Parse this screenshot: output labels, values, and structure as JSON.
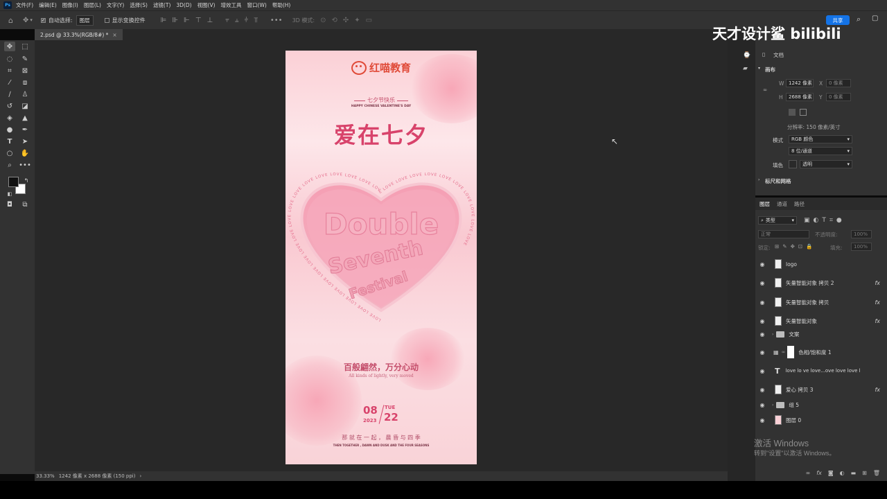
{
  "menubar": {
    "items": [
      "文件(F)",
      "编辑(E)",
      "图像(I)",
      "图层(L)",
      "文字(Y)",
      "选择(S)",
      "滤镜(T)",
      "3D(D)",
      "视图(V)",
      "增效工具",
      "窗口(W)",
      "帮助(H)"
    ]
  },
  "options": {
    "auto_select_label": "自动选择:",
    "auto_select_value": "图层",
    "show_transform_label": "显示变换控件",
    "mode3d_label": "3D 模式:",
    "share_label": "共享"
  },
  "doc_tab": {
    "title": "2.psd @ 33.3%(RGB/8#) *"
  },
  "status": {
    "zoom": "33.33%",
    "info": "1242 像素 x 2688 像素 (150 ppi)"
  },
  "watermark": {
    "text": "天才设计鲨 bilibili"
  },
  "poster": {
    "brand": "红喵教育",
    "subtitle_cn": "七夕节快乐",
    "subtitle_en": "HAPPY CHINESE VALENTINE'S DAY",
    "title": "爱在七夕",
    "heart_ring_text": "LOVE LOVE LOVE LOVE LOVE LOVE LOVE LOVE LOVE LOVE LOVE LOVE LOVE LOVE LOVE LOVE LOVE LOVE LOVE LOVE LOVE LOVE LOVE LOVE LOVE LOVE LOVE LOVE",
    "heart_word1": "Double",
    "heart_word2": "Seventh",
    "heart_word3": "Festival",
    "slogan_cn": "百般翩然，万分心动",
    "slogan_en": "All kinds of lightly, very moved",
    "date_month": "08",
    "date_year": "2023",
    "date_weekday": "TUE",
    "date_day": "22",
    "footer_cn": "那 就 在 一 起 ， 晨 昏 与 四 季",
    "footer_en": "THEN TOGETHER , DAWN AND DUSK AND THE FOUR SEASONS"
  },
  "properties": {
    "doc_label": "文档",
    "canvas_section": "画布",
    "w_label": "W",
    "w_value": "1242 像素",
    "h_label": "H",
    "h_value": "2688 像素",
    "x_label": "X",
    "x_value": "0 像素",
    "y_label": "Y",
    "y_value": "0 像素",
    "resolution": "分辨率: 150 像素/英寸",
    "mode_label": "模式",
    "mode_value": "RGB 颜色",
    "depth_value": "8 位/通道",
    "fill_label": "填色",
    "fill_value": "透明",
    "rulers_section": "标尺和网格"
  },
  "layers": {
    "tabs": [
      "图层",
      "通道",
      "路径"
    ],
    "filter_label": "类型",
    "blend_mode": "正常",
    "opacity_label": "不透明度:",
    "opacity_value": "100%",
    "lock_label": "锁定:",
    "fill_label": "填充:",
    "fill_value": "100%",
    "items": [
      {
        "name": "logo",
        "kind": "smart",
        "fx": ""
      },
      {
        "name": "矢量智能对象 拷贝 2",
        "kind": "smart",
        "fx": "fx"
      },
      {
        "name": "矢量智能对象 拷贝",
        "kind": "smart",
        "fx": "fx"
      },
      {
        "name": "矢量智能对象",
        "kind": "smart",
        "fx": "fx"
      },
      {
        "name": "文案",
        "kind": "folder",
        "fx": ""
      },
      {
        "name": "色相/饱和度 1",
        "kind": "adjust",
        "fx": ""
      },
      {
        "name": "love lo ve love...ove love love l",
        "kind": "text",
        "fx": ""
      },
      {
        "name": "爱心 拷贝 3",
        "kind": "smart",
        "fx": "fx"
      },
      {
        "name": "组 5",
        "kind": "folder",
        "fx": ""
      },
      {
        "name": "图层 0",
        "kind": "pixel",
        "fx": ""
      }
    ]
  },
  "windows_activation": {
    "title": "激活 Windows",
    "subtitle": "转到\"设置\"以激活 Windows。"
  }
}
